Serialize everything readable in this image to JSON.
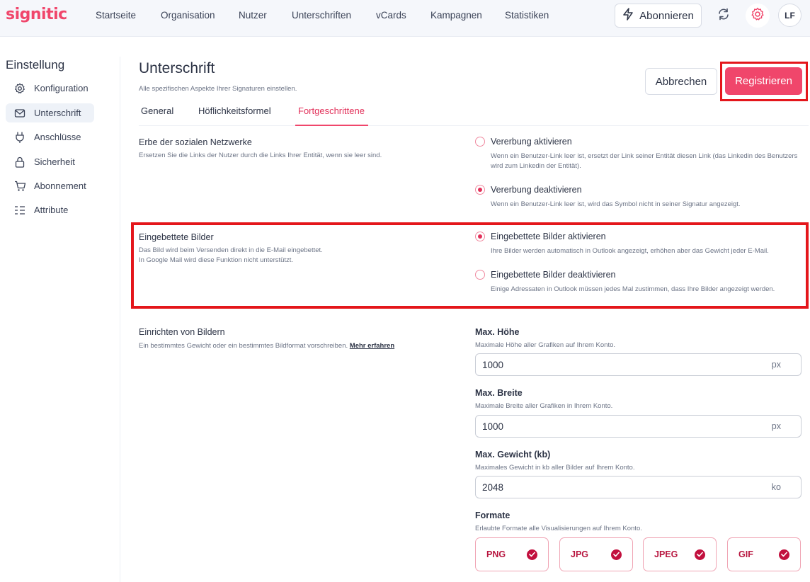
{
  "brand": {
    "logo": "signitic",
    "accent": "#f0466b"
  },
  "nav": {
    "items": [
      "Startseite",
      "Organisation",
      "Nutzer",
      "Unterschriften",
      "vCards",
      "Kampagnen",
      "Statistiken"
    ],
    "subscribe_label": "Abonnieren",
    "avatar_initials": "LF"
  },
  "sidebar": {
    "title": "Einstellung",
    "items": [
      {
        "label": "Konfiguration",
        "icon": "gear-icon"
      },
      {
        "label": "Unterschrift",
        "icon": "mail-icon"
      },
      {
        "label": "Anschlüsse",
        "icon": "plug-icon"
      },
      {
        "label": "Sicherheit",
        "icon": "lock-icon"
      },
      {
        "label": "Abonnement",
        "icon": "cart-icon"
      },
      {
        "label": "Attribute",
        "icon": "list-icon"
      }
    ],
    "active_index": 1
  },
  "header": {
    "title": "Unterschrift",
    "subtitle": "Alle spezifischen Aspekte Ihrer Signaturen einstellen.",
    "cancel_label": "Abbrechen",
    "register_label": "Registrieren"
  },
  "tabs": [
    "General",
    "Höflichkeitsformel",
    "Fortgeschrittene"
  ],
  "active_tab": "Fortgeschrittene",
  "social": {
    "title": "Erbe der sozialen Netzwerke",
    "desc": "Ersetzen Sie die Links der Nutzer durch die Links Ihrer Entität, wenn sie leer sind.",
    "options": [
      {
        "label": "Vererbung aktivieren",
        "desc": "Wenn ein Benutzer-Link leer ist, ersetzt der Link seiner Entität diesen Link (das Linkedin des Benutzers wird zum Linkedin der Entität).",
        "selected": false
      },
      {
        "label": "Vererbung deaktivieren",
        "desc": "Wenn ein Benutzer-Link leer ist, wird das Symbol nicht in seiner Signatur angezeigt.",
        "selected": true
      }
    ]
  },
  "embedded": {
    "title": "Eingebettete Bilder",
    "desc_line1": "Das Bild wird beim Versenden direkt in die E-Mail eingebettet.",
    "desc_line2": "In Google Mail wird diese Funktion nicht unterstützt.",
    "options": [
      {
        "label": "Eingebettete Bilder aktivieren",
        "desc": "Ihre Bilder werden automatisch in Outlook angezeigt, erhöhen aber das Gewicht jeder E-Mail.",
        "selected": true
      },
      {
        "label": "Eingebettete Bilder deaktivieren",
        "desc": "Einige Adressaten in Outlook müssen jedes Mal zustimmen, dass Ihre Bilder angezeigt werden.",
        "selected": false
      }
    ]
  },
  "images": {
    "title": "Einrichten von Bildern",
    "desc": "Ein bestimmtes Gewicht oder ein bestimmtes Bildformat vorschreiben.",
    "more_link": "Mehr erfahren",
    "max_height": {
      "label": "Max. Höhe",
      "hint": "Maximale Höhe aller Grafiken auf Ihrem Konto.",
      "value": "1000",
      "unit": "px"
    },
    "max_width": {
      "label": "Max. Breite",
      "hint": "Maximale Breite aller Grafiken in Ihrem Konto.",
      "value": "1000",
      "unit": "px"
    },
    "max_weight": {
      "label": "Max. Gewicht (kb)",
      "hint": "Maximales Gewicht in kb aller Bilder auf Ihrem Konto.",
      "value": "2048",
      "unit": "ko"
    },
    "formats": {
      "label": "Formate",
      "hint": "Erlaubte Formate alle Visualisierungen auf Ihrem Konto.",
      "items": [
        "PNG",
        "JPG",
        "JPEG",
        "GIF"
      ]
    }
  }
}
